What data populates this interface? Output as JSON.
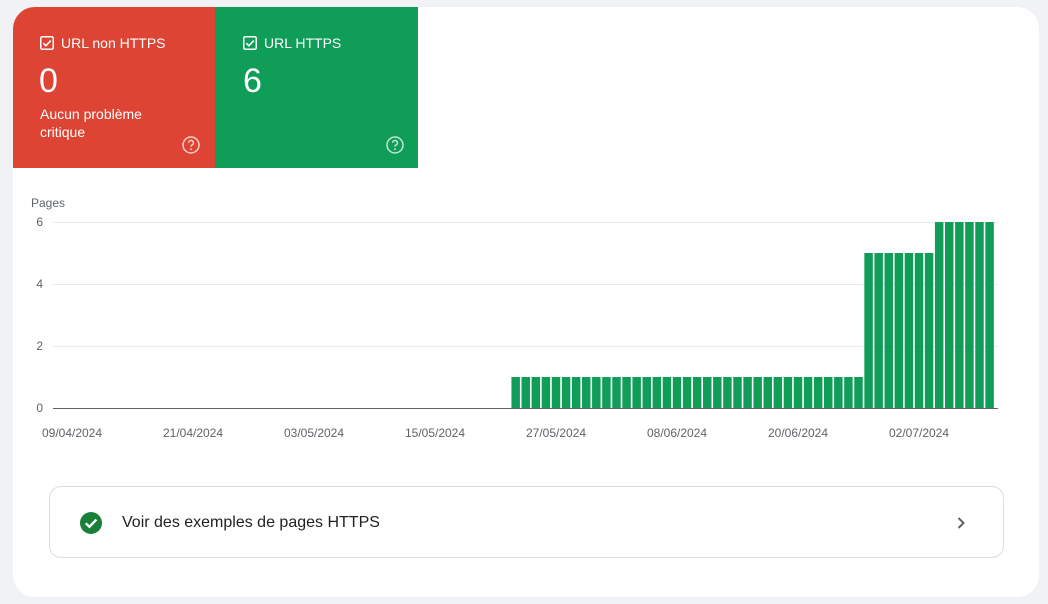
{
  "tiles": [
    {
      "label": "URL non HTTPS",
      "count": "0",
      "subtitle": "Aucun problème critique",
      "color": "#dd4434"
    },
    {
      "label": "URL HTTPS",
      "count": "6",
      "subtitle": "",
      "color": "#0f9d58"
    }
  ],
  "examples_row": {
    "label": "Voir des exemples de pages HTTPS",
    "check_icon": "check-circle-icon",
    "chevron_icon": "chevron-right-icon"
  },
  "chart_data": {
    "type": "bar",
    "ylabel": "Pages",
    "ylim": [
      0,
      6
    ],
    "yticks": [
      0,
      2,
      4,
      6
    ],
    "grid": true,
    "bar_color": "#0f9d58",
    "x_start": "09/04/2024",
    "x_end": "06/07/2024",
    "xtick_labels": [
      "09/04/2024",
      "21/04/2024",
      "03/05/2024",
      "15/05/2024",
      "27/05/2024",
      "08/06/2024",
      "20/06/2024",
      "02/07/2024"
    ],
    "series": [
      {
        "values": [
          0,
          0,
          0,
          0,
          0,
          0,
          0,
          0,
          0,
          0,
          0,
          0,
          0,
          0,
          0,
          0,
          0,
          0,
          0,
          0,
          0,
          0,
          0,
          0,
          0,
          0,
          0,
          0,
          0,
          0,
          0,
          0,
          0,
          0,
          0,
          0,
          0,
          0,
          0,
          0,
          0,
          0,
          0,
          0,
          1,
          1,
          1,
          1,
          1,
          1,
          1,
          1,
          1,
          1,
          1,
          1,
          1,
          1,
          1,
          1,
          1,
          1,
          1,
          1,
          1,
          1,
          1,
          1,
          1,
          1,
          1,
          1,
          1,
          1,
          1,
          1,
          1,
          1,
          1,
          5,
          5,
          5,
          5,
          5,
          5,
          5,
          6,
          6,
          6,
          6,
          6,
          6
        ]
      }
    ]
  }
}
